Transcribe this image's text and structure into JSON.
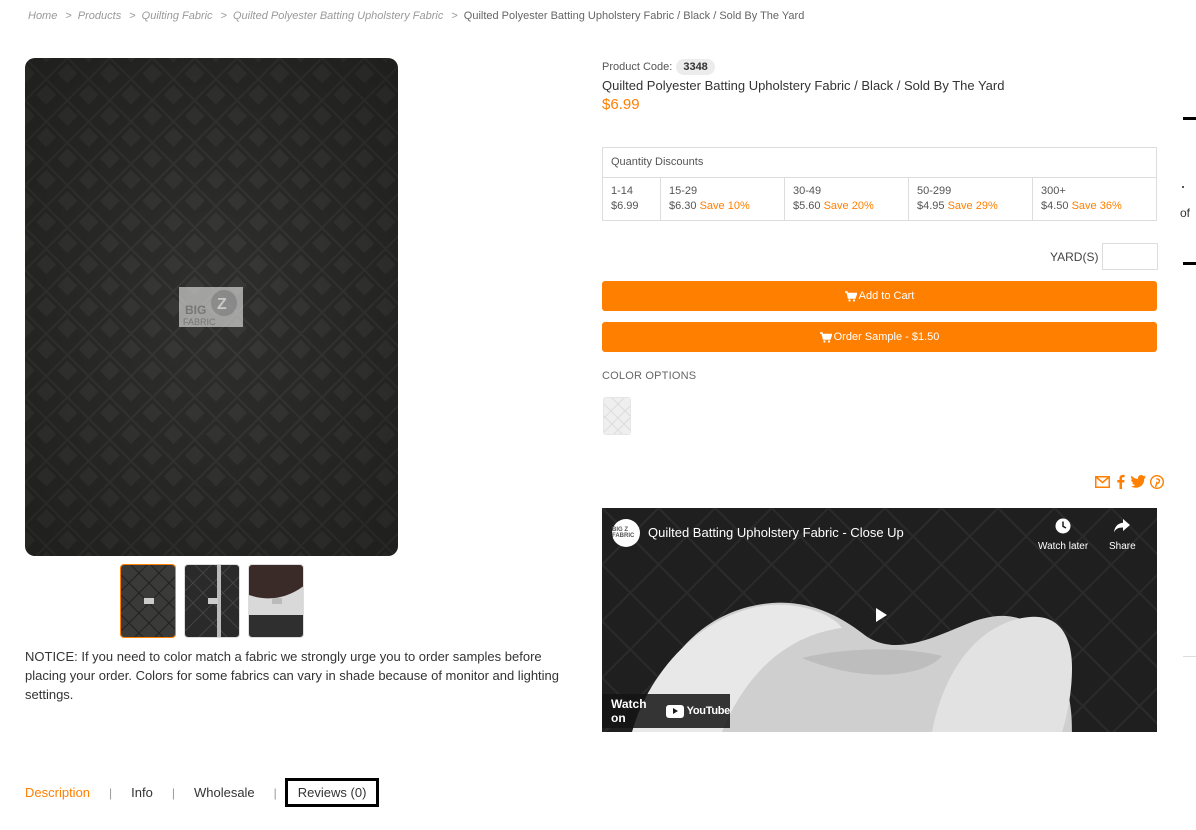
{
  "breadcrumb": {
    "items": [
      "Home",
      "Products",
      "Quilting Fabric",
      "Quilted Polyester Batting Upholstery Fabric"
    ],
    "current": "Quilted Polyester Batting Upholstery Fabric / Black / Sold By The Yard"
  },
  "product": {
    "code_label": "Product Code:",
    "code": "3348",
    "title": "Quilted Polyester Batting Upholstery Fabric / Black / Sold By The Yard",
    "price": "$6.99",
    "image_logo_text": "BIG Z FABRIC"
  },
  "discounts": {
    "header": "Quantity Discounts",
    "tiers": [
      {
        "range": "1-14",
        "price": "$6.99",
        "save": ""
      },
      {
        "range": "15-29",
        "price": "$6.30",
        "save": "Save 10%"
      },
      {
        "range": "30-49",
        "price": "$5.60",
        "save": "Save 20%"
      },
      {
        "range": "50-299",
        "price": "$4.95",
        "save": "Save 29%"
      },
      {
        "range": "300+",
        "price": "$4.50",
        "save": "Save 36%"
      }
    ]
  },
  "quantity": {
    "label": "YARD(S)",
    "value": ""
  },
  "buttons": {
    "add_to_cart": "Add to Cart",
    "order_sample": "Order Sample - $1.50"
  },
  "color_options": {
    "label": "COLOR OPTIONS"
  },
  "notice": "NOTICE: If you need to color match a fabric we strongly urge you to order samples before placing your order. Colors for some fabrics can vary in shade because of monitor and lighting settings.",
  "video": {
    "title": "Quilted Batting Upholstery Fabric - Close Up",
    "watch_later": "Watch later",
    "share": "Share",
    "watch_on": "Watch on",
    "youtube": "YouTube",
    "channel": "BIG Z FABRIC"
  },
  "tabs": [
    "Description",
    "Info",
    "Wholesale",
    "Reviews (0)"
  ],
  "edge_text": "of",
  "colors": {
    "accent": "#ff7f00",
    "text": "#333333",
    "border": "#dddddd"
  }
}
